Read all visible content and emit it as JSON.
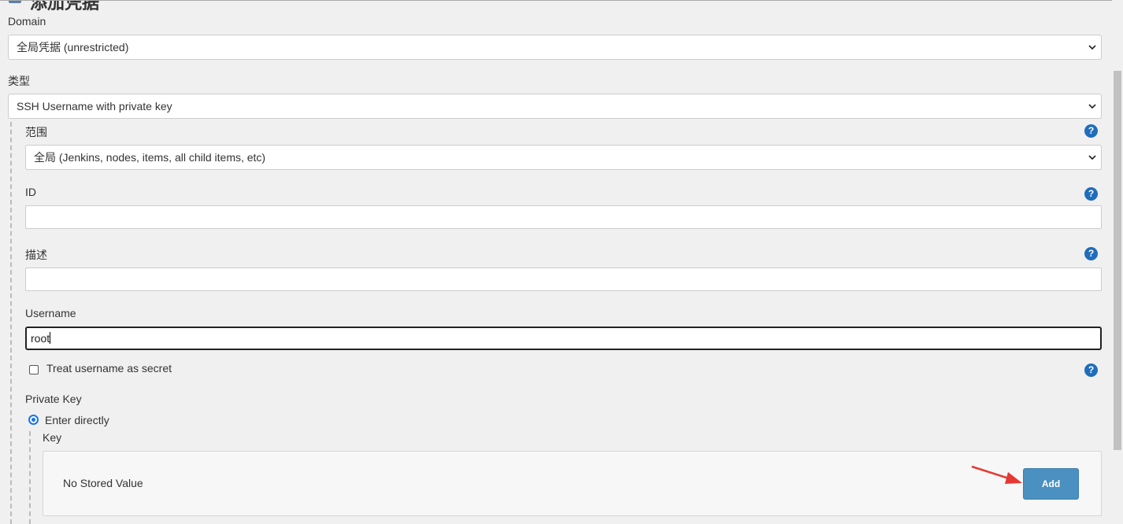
{
  "header": {
    "title": "添加凭据"
  },
  "domain": {
    "label": "Domain",
    "value": "全局凭据 (unrestricted)"
  },
  "kind": {
    "label": "类型",
    "value": "SSH Username with private key"
  },
  "scope": {
    "label": "范围",
    "value": "全局 (Jenkins, nodes, items, all child items, etc)",
    "help": "?"
  },
  "id_field": {
    "label": "ID",
    "value": "",
    "help": "?"
  },
  "description": {
    "label": "描述",
    "value": "",
    "help": "?"
  },
  "username": {
    "label": "Username",
    "value": "root"
  },
  "treat_secret": {
    "label": "Treat username as secret",
    "checked": false,
    "help": "?"
  },
  "private_key": {
    "label": "Private Key",
    "option_label": "Enter directly",
    "key_label": "Key",
    "stored_text": "No Stored Value",
    "add_label": "Add"
  },
  "colors": {
    "accent": "#1f6dbb",
    "button": "#4a90c0",
    "arrow": "#e53935"
  }
}
